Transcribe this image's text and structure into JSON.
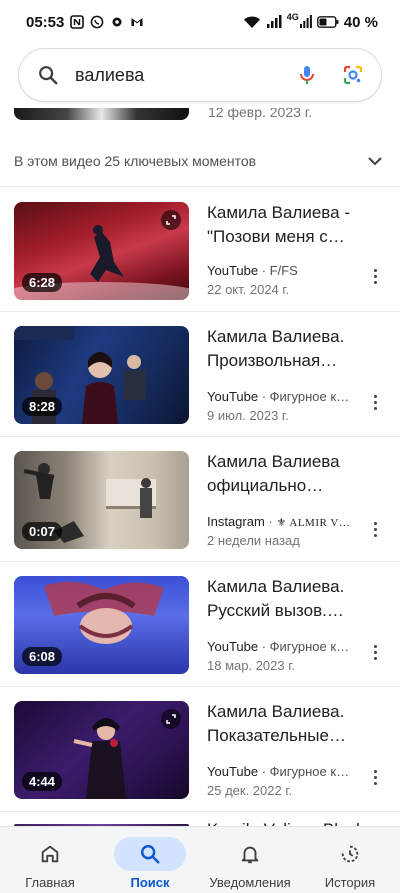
{
  "status_bar": {
    "time": "05:53",
    "network": "4G",
    "battery": "40 %"
  },
  "search": {
    "query": "валиева"
  },
  "previous_result": {
    "date": "12 февр. 2023 г."
  },
  "key_moments": {
    "label": "В этом видео 25 ключевых моментов"
  },
  "results": [
    {
      "title_line1": "Камила Валиева -",
      "title_line2": "\"Позови меня с…",
      "duration": "6:28",
      "source": "YouTube",
      "channel": "F/FS",
      "date": "22 окт. 2024 г.",
      "has_expand": true
    },
    {
      "title_line1": "Камила Валиева.",
      "title_line2": "Произвольная…",
      "duration": "8:28",
      "source": "YouTube",
      "channel": "Фигурное к…",
      "date": "9 июл. 2023 г.",
      "has_expand": false
    },
    {
      "title_line1": "Камила Валиева",
      "title_line2": "официально…",
      "duration": "0:07",
      "source": "Instagram",
      "channel": "⚜ ALMIR V…",
      "date": "2 недели назад",
      "has_expand": false
    },
    {
      "title_line1": "Камила Валиева.",
      "title_line2": "Русский вызов.…",
      "duration": "6:08",
      "source": "YouTube",
      "channel": "Фигурное к…",
      "date": "18 мар. 2023 г.",
      "has_expand": false
    },
    {
      "title_line1": "Камила Валиева.",
      "title_line2": "Показательные…",
      "duration": "4:44",
      "source": "YouTube",
      "channel": "Фигурное к…",
      "date": "25 дек. 2022 г.",
      "has_expand": true
    }
  ],
  "next_result": {
    "title_partial": "Kamila Valieva Black"
  },
  "nav": {
    "home": "Главная",
    "search": "Поиск",
    "notifications": "Уведомления",
    "history": "История"
  }
}
